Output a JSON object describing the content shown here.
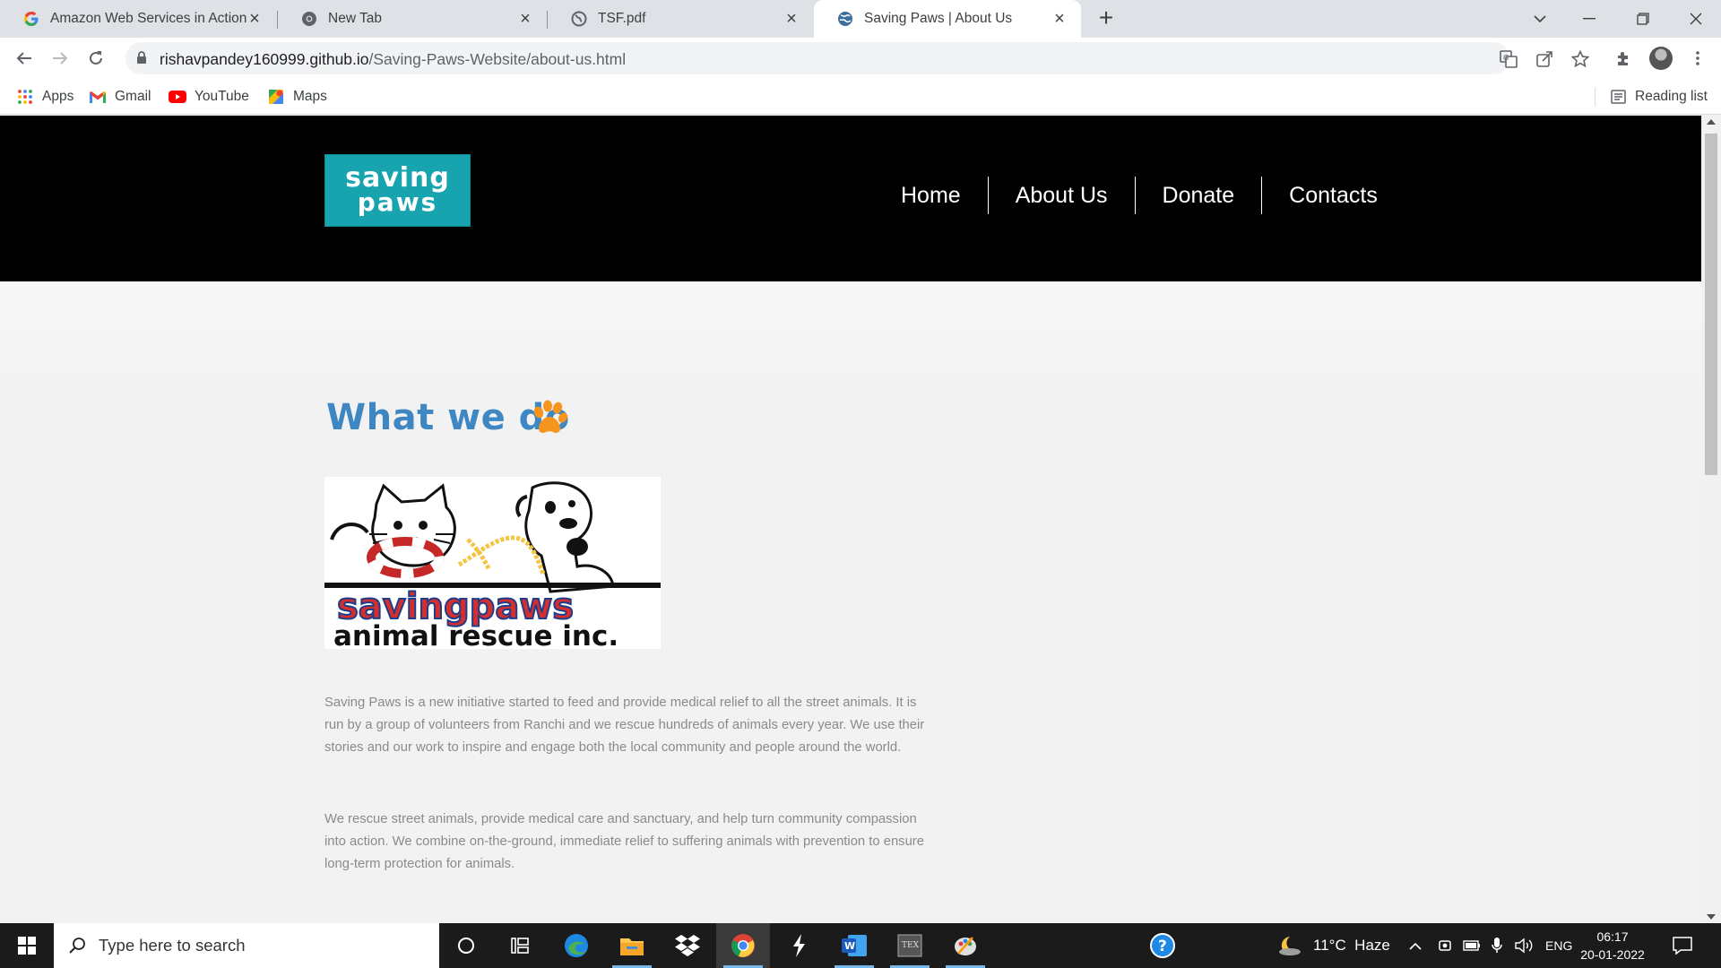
{
  "browser": {
    "tabs": [
      {
        "title": "Amazon Web Services in Action -",
        "favicon": "google-icon",
        "active": false
      },
      {
        "title": "New Tab",
        "favicon": "chrome-icon",
        "active": false
      },
      {
        "title": "TSF.pdf",
        "favicon": "globe-icon",
        "active": false
      },
      {
        "title": "Saving Paws | About Us",
        "favicon": "site-globe-icon",
        "active": true
      }
    ],
    "url_host": "rishavpandey160999.github.io",
    "url_path": "/Saving-Paws-Website/about-us.html",
    "bookmarks": [
      {
        "label": "Apps",
        "icon": "apps-grid-icon"
      },
      {
        "label": "Gmail",
        "icon": "gmail-icon"
      },
      {
        "label": "YouTube",
        "icon": "youtube-icon"
      },
      {
        "label": "Maps",
        "icon": "maps-icon"
      }
    ],
    "reading_list": "Reading list"
  },
  "site": {
    "logo_line1": "saving",
    "logo_line2": "paws",
    "nav": [
      "Home",
      "About Us",
      "Donate",
      "Contacts"
    ],
    "current_nav": "About Us",
    "heading": "What we do",
    "image_text_brand": "savingpaws",
    "image_text_sub": "animal rescue inc.",
    "paragraph1": "Saving Paws is a new initiative started to feed and provide medical relief to all the street animals. It is run by a group of volunteers from Ranchi and we rescue hundreds of animals every year. We use their stories and our work to inspire and engage both the local community and people around the world.",
    "paragraph2": "We rescue street animals, provide medical care and sanctuary, and help turn community compassion into action. We combine on-the-ground, immediate relief to suffering animals with prevention to ensure long-term protection for animals."
  },
  "colors": {
    "header_bg": "#000000",
    "logo_bg": "#18a4ae",
    "heading": "#3f87c2",
    "paw": "#f7941d",
    "body_text": "#8a8a8a"
  },
  "taskbar": {
    "search_placeholder": "Type here to search",
    "weather": "11°C  Haze",
    "language": "ENG",
    "time": "06:17",
    "date": "20-01-2022"
  }
}
